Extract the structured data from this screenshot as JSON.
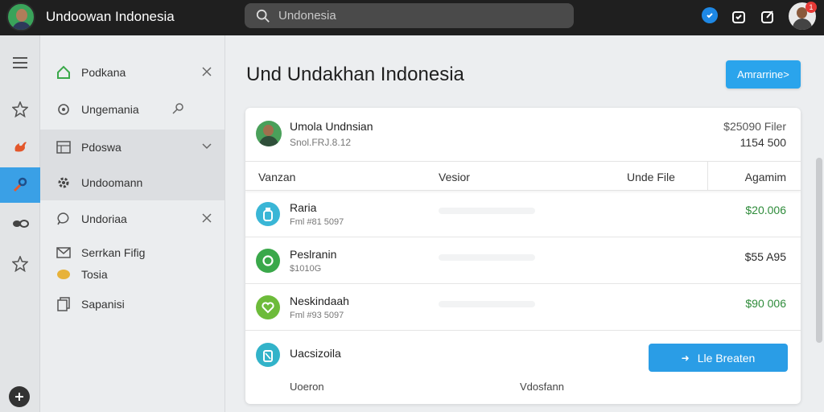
{
  "app": {
    "title": "Undoowan Indonesia"
  },
  "search": {
    "placeholder": "Undonesia"
  },
  "header": {
    "notification_count": "1"
  },
  "nav": {
    "items": [
      {
        "label": "Podkana"
      },
      {
        "label": "Ungemania"
      },
      {
        "label": "Pdoswa"
      },
      {
        "label": "Undoomann"
      },
      {
        "label": "Undoriaa"
      },
      {
        "label": "Serrkan Fifig"
      },
      {
        "label": "Tosia"
      },
      {
        "label": "Sapanisi"
      }
    ]
  },
  "main": {
    "title": "Und Undakhan Indonesia",
    "primary_button": "Amrarrine>",
    "card": {
      "name": "Umola Undnsian",
      "sub": "Snol.FRJ.8.12",
      "amount_primary": "$25090 Filer",
      "amount_secondary": "1154 500"
    },
    "columns": [
      "Vanzan",
      "Vesior",
      "Unde File",
      "Agamim"
    ],
    "rows": [
      {
        "name": "Raria",
        "sub": "Fml #81 5097",
        "amount": "$20.006",
        "amount_color": "#2e8b3a",
        "icon": "bottle-icon",
        "icon_color": "#3ab6d6"
      },
      {
        "name": "Peslranin",
        "sub": "$1010G",
        "amount": "$55 A95",
        "amount_color": "#2a2a2a",
        "icon": "chat-icon",
        "icon_color": "#3aa84a"
      },
      {
        "name": "Neskindaah",
        "sub": "Fml #93 5097",
        "amount": "$90 006",
        "amount_color": "#2e8b3a",
        "icon": "heart-icon",
        "icon_color": "#6dbb3a"
      }
    ],
    "footer": {
      "name": "Uacsizoila",
      "button": "Lle Breaten",
      "label_left": "Uoeron",
      "label_right": "Vdosfann"
    }
  },
  "colors": {
    "accent": "#2aa4ec",
    "topbar": "#1f1f1f",
    "positive": "#2e8b3a"
  }
}
